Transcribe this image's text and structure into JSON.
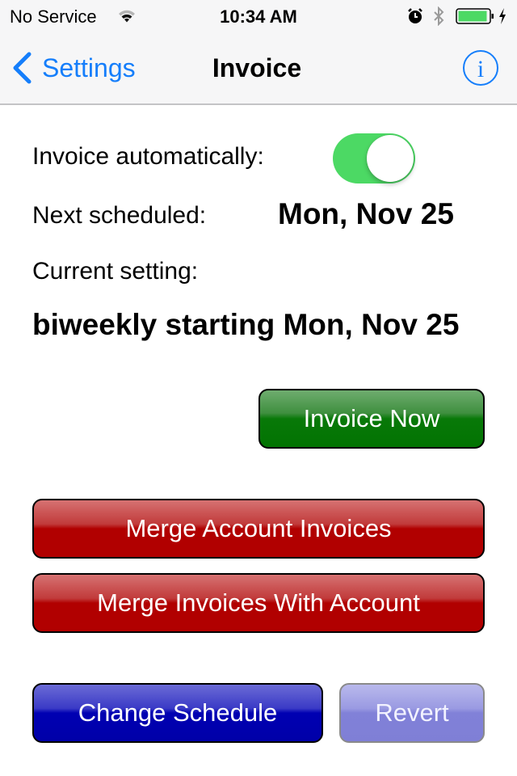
{
  "status_bar": {
    "carrier": "No Service",
    "time": "10:34 AM",
    "icons": [
      "wifi-icon",
      "alarm-icon",
      "bluetooth-icon",
      "battery-icon",
      "charging-icon"
    ],
    "battery_color": "#4cd964"
  },
  "nav": {
    "back_label": "Settings",
    "title": "Invoice",
    "info_icon": "info-icon",
    "accent_color": "#157efb"
  },
  "form": {
    "auto_label": "Invoice automatically:",
    "auto_enabled": true,
    "next_label": "Next scheduled:",
    "next_value": "Mon, Nov 25",
    "current_label": "Current setting:",
    "current_value": "biweekly starting Mon, Nov 25"
  },
  "buttons": {
    "invoice_now": "Invoice Now",
    "merge_account_invoices": "Merge Account Invoices",
    "merge_invoices_with_account": "Merge Invoices With Account",
    "change_schedule": "Change Schedule",
    "revert": "Revert"
  },
  "colors": {
    "toggle_on": "#4cd964",
    "invoice_now": "#027302",
    "merge": "#b10000",
    "change_schedule": "#0000b2",
    "revert": "#8181d8"
  }
}
